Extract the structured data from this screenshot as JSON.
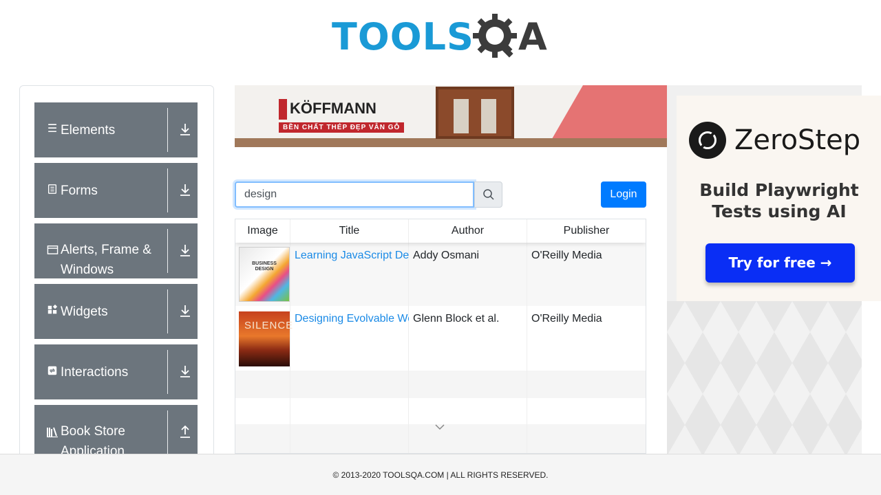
{
  "header": {
    "logo_tools": "TOOLS",
    "logo_qa": "A"
  },
  "sidebar": {
    "groups": [
      {
        "label": "Elements",
        "icon": "hamburger-icon",
        "arrow": "download-arrow-icon"
      },
      {
        "label": "Forms",
        "icon": "document-icon",
        "arrow": "download-arrow-icon"
      },
      {
        "label": "Alerts, Frame & Windows",
        "icon": "window-icon",
        "arrow": "download-arrow-icon"
      },
      {
        "label": "Widgets",
        "icon": "widgets-icon",
        "arrow": "download-arrow-icon"
      },
      {
        "label": "Interactions",
        "icon": "interactions-icon",
        "arrow": "download-arrow-icon"
      },
      {
        "label": "Book Store Application",
        "icon": "books-icon",
        "arrow": "upload-arrow-icon"
      }
    ]
  },
  "banner": {
    "brand": "KÖFFMANN",
    "tagline": "BỀN CHẤT THÉP  ĐẸP VÂN GỖ"
  },
  "search": {
    "value": "design"
  },
  "login": {
    "label": "Login"
  },
  "table": {
    "headers": [
      "Image",
      "Title",
      "Author",
      "Publisher"
    ],
    "rows": [
      {
        "image_text": "BUSINESS DESIGN",
        "title": "Learning JavaScript Design Patterns",
        "author": "Addy Osmani",
        "publisher": "O'Reilly Media"
      },
      {
        "image_text": "SILENCE",
        "title": "Designing Evolvable Web APIs with ASP.NET",
        "author": "Glenn Block et al.",
        "publisher": "O'Reilly Media"
      }
    ]
  },
  "ad": {
    "name": "ZeroStep",
    "tagline": "Build Playwright Tests using AI",
    "cta": "Try for free →"
  },
  "footer": {
    "text": "© 2013-2020 TOOLSQA.COM | ALL RIGHTS RESERVED."
  },
  "colors": {
    "primary": "#007bff",
    "sidebar_group": "#6c757d",
    "link": "#1a8ae6",
    "logo_blue": "#1a9ad6",
    "cta_blue": "#0a2ef5"
  }
}
